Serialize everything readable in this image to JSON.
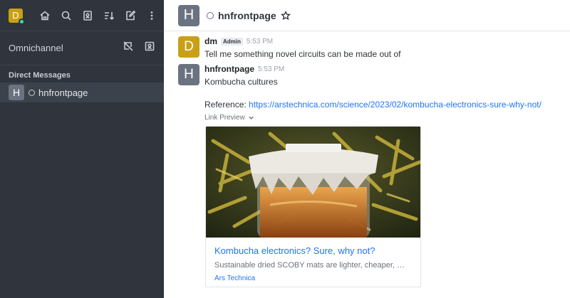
{
  "user": {
    "initial": "D",
    "status_color": "#2de0a5",
    "avatar_color": "#c9a015"
  },
  "sidebar": {
    "toolbar_icons": [
      "home-icon",
      "search-icon",
      "directory-icon",
      "sort-icon",
      "create-new-icon",
      "kebab-menu-icon"
    ],
    "omnichannel_label": "Omnichannel",
    "section_title": "Direct Messages",
    "items": [
      {
        "initial": "H",
        "label": "hnfrontpage"
      }
    ]
  },
  "header": {
    "initial": "H",
    "title": "hnfrontpage"
  },
  "messages": [
    {
      "initial": "H",
      "author": "dm",
      "badge": "Admin",
      "time": "5:53 PM",
      "text": "Tell me something novel circuits can be made out of",
      "avatar_letter": "D",
      "avatar_color": "#c9a015"
    },
    {
      "initial": "H",
      "author": "hnfrontpage",
      "time": "5:53 PM",
      "text": "Kombucha cultures",
      "reference_label": "Reference:",
      "reference_url": "https://arstechnica.com/science/2023/02/kombucha-electronics-sure-why-not/",
      "avatar_letter": "H",
      "avatar_color": "#6b7280"
    }
  ],
  "link_preview": {
    "toggle_label": "Link Preview",
    "title": "Kombucha electronics? Sure, why not?",
    "description": "Sustainable dried SCOBY mats are lighter, cheaper, …",
    "site": "Ars Technica"
  },
  "colors": {
    "sidebar_bg": "#2f343d",
    "link": "#1d74f5",
    "accent": "#1d74f5"
  }
}
